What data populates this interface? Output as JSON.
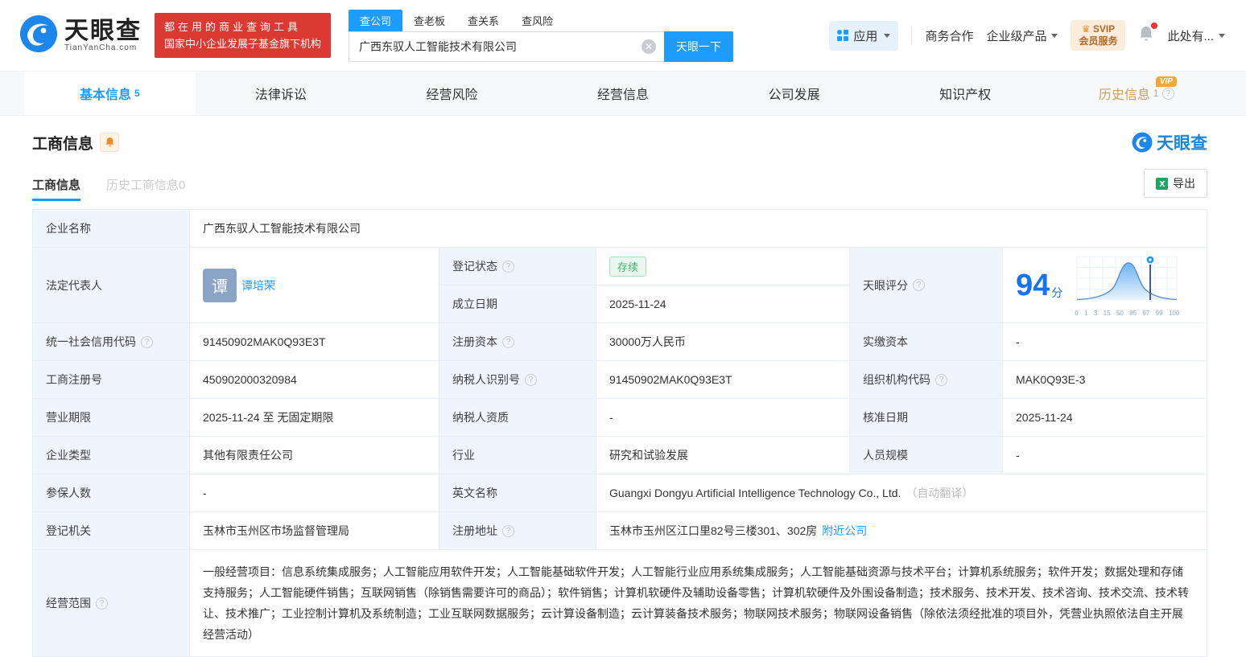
{
  "colors": {
    "accent": "#1e9bff",
    "brand_red": "#db3a33",
    "gold": "#c9a158",
    "status_green": "#3ab56d",
    "score_blue": "#1673f0",
    "label_bg": "#eef5fc"
  },
  "icons": {
    "logo": "tianyancha-swirl",
    "apps": "grid-icon",
    "dropdown": "caret-down",
    "svip": "crown",
    "notification": "bell-with-red-dot",
    "clear": "circle-x",
    "subscribe": "orange-bell",
    "export": "excel",
    "help": "question-circle",
    "score_marker": "pin"
  },
  "brand": {
    "name": "天眼查",
    "domain": "TianYanCha.com",
    "slogan_line1": "都在用的商业查询工具",
    "slogan_line2": "国家中小企业发展子基金旗下机构"
  },
  "search": {
    "tabs": [
      {
        "label": "查公司"
      },
      {
        "label": "查老板"
      },
      {
        "label": "查关系"
      },
      {
        "label": "查风险"
      }
    ],
    "value": "广西东驭人工智能技术有限公司",
    "button": "天眼一下"
  },
  "header_right": {
    "apps": "应用",
    "business": "商务合作",
    "enterprise": "企业级产品",
    "svip_line1": "SVIP",
    "svip_line2": "会员服务",
    "user": "此处有..."
  },
  "nav_tabs": [
    {
      "label": "基本信息",
      "count": "5"
    },
    {
      "label": "法律诉讼"
    },
    {
      "label": "经营风险"
    },
    {
      "label": "经营信息"
    },
    {
      "label": "公司发展"
    },
    {
      "label": "知识产权"
    },
    {
      "label": "历史信息",
      "count": "1",
      "vip_tag": "VIP"
    }
  ],
  "section": {
    "title": "工商信息",
    "watermark": "天眼查",
    "subtabs": [
      {
        "label": "工商信息"
      },
      {
        "label": "历史工商信息",
        "count": "0"
      }
    ],
    "export_label": "导出"
  },
  "fields": {
    "company_name_label": "企业名称",
    "company_name": "广西东驭人工智能技术有限公司",
    "legal_rep_label": "法定代表人",
    "legal_rep_avatar": "谭",
    "legal_rep": "谭培荣",
    "reg_status_label": "登记状态",
    "reg_status": "存续",
    "est_date_label": "成立日期",
    "est_date": "2025-11-24",
    "score_label": "天眼评分",
    "score": "94",
    "score_unit": "分",
    "credit_code_label": "统一社会信用代码",
    "credit_code": "91450902MAK0Q93E3T",
    "reg_capital_label": "注册资本",
    "reg_capital": "30000万人民币",
    "paid_capital_label": "实缴资本",
    "paid_capital": "-",
    "reg_number_label": "工商注册号",
    "reg_number": "450902000320984",
    "taxpayer_id_label": "纳税人识别号",
    "taxpayer_id": "91450902MAK0Q93E3T",
    "org_code_label": "组织机构代码",
    "org_code": "MAK0Q93E-3",
    "business_term_label": "营业期限",
    "business_term": "2025-11-24 至 无固定期限",
    "taxpayer_qual_label": "纳税人资质",
    "taxpayer_qual": "-",
    "approval_date_label": "核准日期",
    "approval_date": "2025-11-24",
    "company_type_label": "企业类型",
    "company_type": "其他有限责任公司",
    "industry_label": "行业",
    "industry": "研究和试验发展",
    "staff_size_label": "人员规模",
    "staff_size": "-",
    "insured_label": "参保人数",
    "insured": "-",
    "english_name_label": "英文名称",
    "english_name": "Guangxi Dongyu Artificial Intelligence Technology Co., Ltd.",
    "english_name_note": "（自动翻译）",
    "registry_label": "登记机关",
    "registry": "玉林市玉州区市场监督管理局",
    "address_label": "注册地址",
    "address": "玉林市玉州区江口里82号三楼301、302房",
    "nearby_link": "附近公司",
    "scope_label": "经营范围",
    "scope": "一般经营项目：信息系统集成服务；人工智能应用软件开发；人工智能基础软件开发；人工智能行业应用系统集成服务；人工智能基础资源与技术平台；计算机系统服务；软件开发；数据处理和存储支持服务；人工智能硬件销售；互联网销售（除销售需要许可的商品）；软件销售；计算机软硬件及辅助设备零售；计算机软硬件及外围设备制造；技术服务、技术开发、技术咨询、技术交流、技术转让、技术推广；工业控制计算机及系统制造；工业互联网数据服务；云计算设备制造；云计算装备技术服务；物联网技术服务；物联网设备销售（除依法须经批准的项目外，凭营业执照依法自主开展经营活动）"
  },
  "score_chart": {
    "type": "area",
    "description": "score distribution bell curve with marker at company score",
    "marker_value": 94,
    "ticks": [
      "0",
      "1",
      "3",
      "15",
      "50",
      "85",
      "97",
      "99",
      "100"
    ]
  }
}
